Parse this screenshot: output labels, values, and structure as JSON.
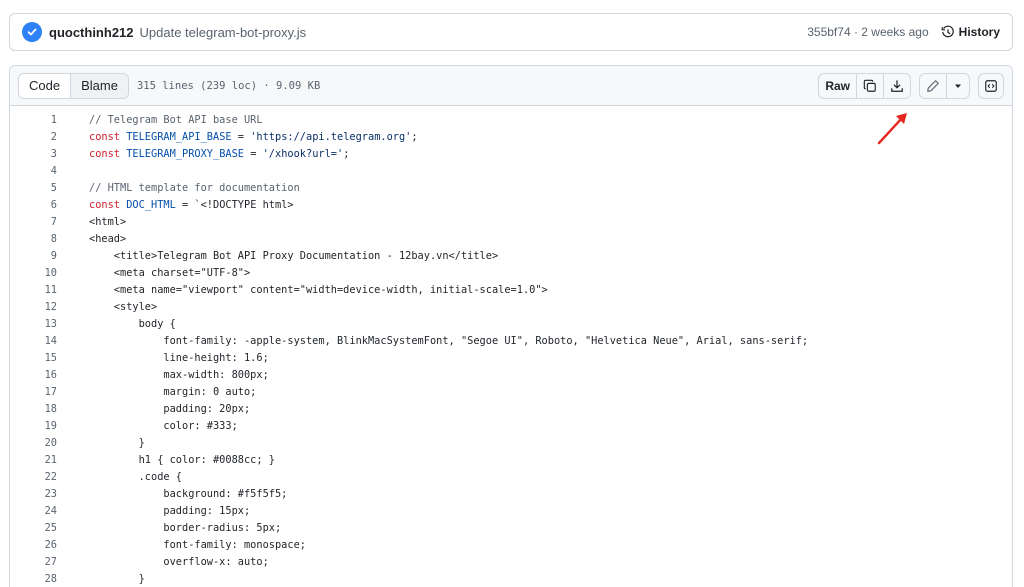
{
  "commit": {
    "author": "quocthinh212",
    "message": "Update telegram-bot-proxy.js",
    "meta": "355bf74 · 2 weeks ago",
    "history_label": "History"
  },
  "file": {
    "tab_code": "Code",
    "tab_blame": "Blame",
    "meta": "315 lines (239 loc) · 9.09 KB",
    "raw_label": "Raw"
  },
  "accent": {
    "blue": "#2f81f7",
    "arrow": "#e5261f"
  },
  "icons": [
    "check-badge-icon",
    "history-icon",
    "copy-icon",
    "download-icon",
    "pencil-icon",
    "caret-down-icon",
    "symbols-icon"
  ],
  "lines": [
    {
      "n": "1",
      "text": "// Telegram Bot API base URL"
    },
    {
      "n": "2",
      "text": "const TELEGRAM_API_BASE = 'https://api.telegram.org';"
    },
    {
      "n": "3",
      "text": "const TELEGRAM_PROXY_BASE = '/xhook?url=';"
    },
    {
      "n": "4",
      "text": ""
    },
    {
      "n": "5",
      "text": "// HTML template for documentation"
    },
    {
      "n": "6",
      "text": "const DOC_HTML = `<!DOCTYPE html>"
    },
    {
      "n": "7",
      "text": "<html>"
    },
    {
      "n": "8",
      "text": "<head>"
    },
    {
      "n": "9",
      "text": "    <title>Telegram Bot API Proxy Documentation - 12bay.vn</title>"
    },
    {
      "n": "10",
      "text": "    <meta charset=\"UTF-8\">"
    },
    {
      "n": "11",
      "text": "    <meta name=\"viewport\" content=\"width=device-width, initial-scale=1.0\">"
    },
    {
      "n": "12",
      "text": "    <style>"
    },
    {
      "n": "13",
      "text": "        body {"
    },
    {
      "n": "14",
      "text": "            font-family: -apple-system, BlinkMacSystemFont, \"Segoe UI\", Roboto, \"Helvetica Neue\", Arial, sans-serif;"
    },
    {
      "n": "15",
      "text": "            line-height: 1.6;"
    },
    {
      "n": "16",
      "text": "            max-width: 800px;"
    },
    {
      "n": "17",
      "text": "            margin: 0 auto;"
    },
    {
      "n": "18",
      "text": "            padding: 20px;"
    },
    {
      "n": "19",
      "text": "            color: #333;"
    },
    {
      "n": "20",
      "text": "        }"
    },
    {
      "n": "21",
      "text": "        h1 { color: #0088cc; }"
    },
    {
      "n": "22",
      "text": "        .code {"
    },
    {
      "n": "23",
      "text": "            background: #f5f5f5;"
    },
    {
      "n": "24",
      "text": "            padding: 15px;"
    },
    {
      "n": "25",
      "text": "            border-radius: 5px;"
    },
    {
      "n": "26",
      "text": "            font-family: monospace;"
    },
    {
      "n": "27",
      "text": "            overflow-x: auto;"
    },
    {
      "n": "28",
      "text": "        }"
    }
  ]
}
